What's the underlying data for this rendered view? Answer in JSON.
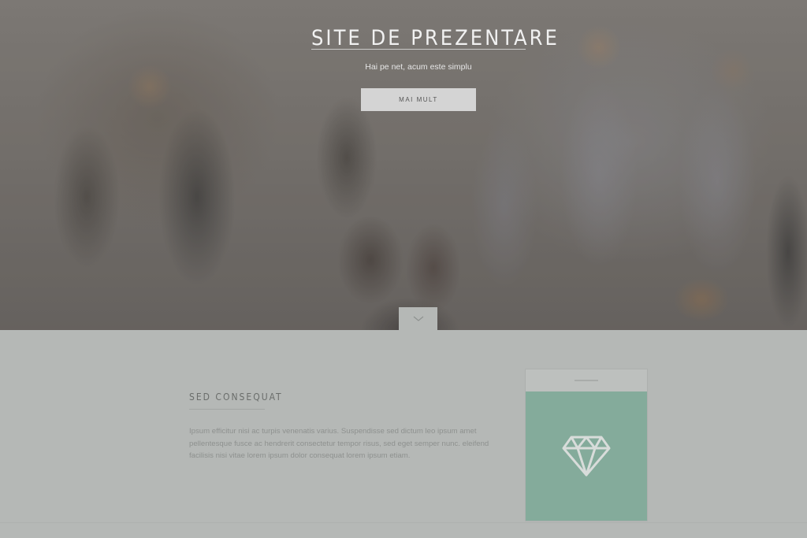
{
  "hero": {
    "title": "SITE DE PREZENTARE",
    "subtitle": "Hai pe net, acum este simplu",
    "button_label": "MAI MULT"
  },
  "feature": {
    "title": "SED CONSEQUAT",
    "body": "Ipsum efficitur nisi ac turpis venenatis varius. Suspendisse sed dictum leo ipsum amet pellentesque fusce ac hendrerit consectetur tempor risus, sed eget semper nunc. eleifend facilisis nisi vitae lorem ipsum dolor consequat lorem ipsum etiam.",
    "card_icon": "diamond-icon"
  },
  "colors": {
    "accent": "#84ab9b",
    "page_bg": "#b5b8b6"
  }
}
